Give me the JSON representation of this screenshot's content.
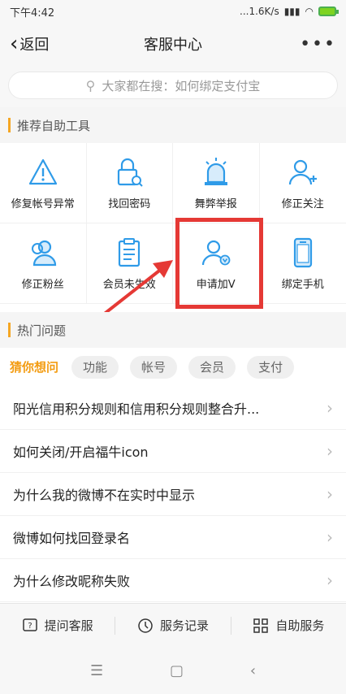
{
  "status": {
    "time": "下午4:42",
    "right": "...1.6K/s"
  },
  "header": {
    "back_label": "返回",
    "title": "客服中心"
  },
  "search": {
    "placeholder": "大家都在搜：如何绑定支付宝"
  },
  "tools_section": {
    "title": "推荐自助工具"
  },
  "tools": [
    {
      "label": "修复帐号异常",
      "icon": "warning-icon"
    },
    {
      "label": "找回密码",
      "icon": "lock-search-icon"
    },
    {
      "label": "舞弊举报",
      "icon": "alarm-icon"
    },
    {
      "label": "修正关注",
      "icon": "user-add-icon"
    },
    {
      "label": "修正粉丝",
      "icon": "users-icon"
    },
    {
      "label": "会员未生效",
      "icon": "clipboard-icon"
    },
    {
      "label": "申请加V",
      "icon": "user-verified-icon"
    },
    {
      "label": "绑定手机",
      "icon": "phone-icon"
    }
  ],
  "hot_section": {
    "title": "热门问题"
  },
  "tabs": [
    "猜你想问",
    "功能",
    "帐号",
    "会员",
    "支付"
  ],
  "questions": [
    "阳光信用积分规则和信用积分规则整合升...",
    "如何关闭/开启福牛icon",
    "为什么我的微博不在实时中显示",
    "微博如何找回登录名",
    "为什么修改昵称失败"
  ],
  "bottom": {
    "ask": "提问客服",
    "records": "服务记录",
    "self": "自助服务"
  },
  "colors": {
    "accent": "#f5a623",
    "icon_blue": "#2f9be8",
    "highlight": "#e53935"
  }
}
